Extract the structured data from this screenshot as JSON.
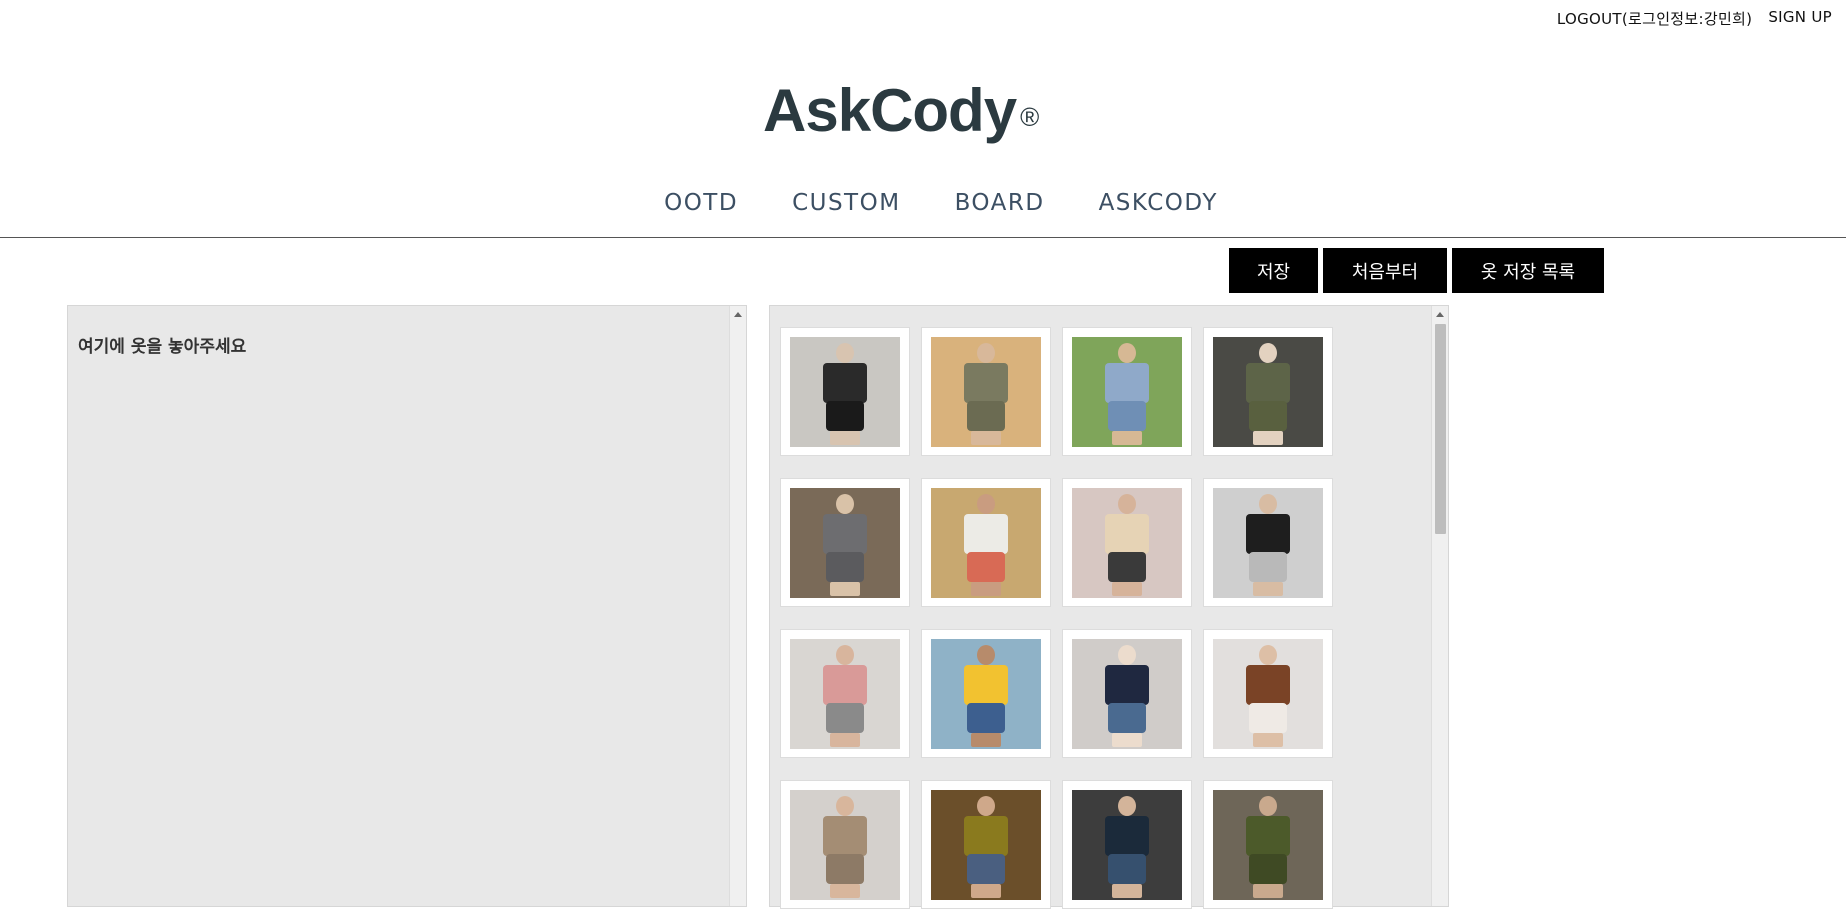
{
  "header": {
    "logout_label": "LOGOUT(로그인정보:강민희)",
    "signup_label": "SIGN UP"
  },
  "logo": {
    "text": "AskCody",
    "mark": "®"
  },
  "nav": {
    "items": [
      {
        "label": "OOTD"
      },
      {
        "label": "CUSTOM"
      },
      {
        "label": "BOARD"
      },
      {
        "label": "ASKCODY"
      }
    ]
  },
  "actions": {
    "save_label": "저장",
    "reset_label": "처음부터",
    "saved_list_label": "옷 저장 목록"
  },
  "drop_area": {
    "hint": "여기에 옷을 놓아주세요"
  },
  "clothes": [
    {
      "bg": "#c9c7c2",
      "top": "#2a2a2a",
      "bottom": "#1a1a1a",
      "skin": "#d8c4b0"
    },
    {
      "bg": "#d9b27c",
      "top": "#7a7a60",
      "bottom": "#6b6b52",
      "skin": "#d8b89a"
    },
    {
      "bg": "#7fa55a",
      "top": "#8fa9c9",
      "bottom": "#6f8fb5",
      "skin": "#d6b894"
    },
    {
      "bg": "#4a4a45",
      "top": "#5d6448",
      "bottom": "#59603f",
      "skin": "#e3d2c0"
    },
    {
      "bg": "#7a6a58",
      "top": "#6d6d70",
      "bottom": "#5b5b5e",
      "skin": "#d9c2a8"
    },
    {
      "bg": "#c8a870",
      "top": "#ecebe6",
      "bottom": "#d86a55",
      "skin": "#c99c80"
    },
    {
      "bg": "#d7c7c2",
      "top": "#e6d3b5",
      "bottom": "#3a3a3a",
      "skin": "#d6b39a"
    },
    {
      "bg": "#cfcfcf",
      "top": "#1e1e1e",
      "bottom": "#b9b9b9",
      "skin": "#d8bca3"
    },
    {
      "bg": "#d9d6d2",
      "top": "#d99a98",
      "bottom": "#8a8a8a",
      "skin": "#d8b59d"
    },
    {
      "bg": "#8fb2c7",
      "top": "#f2c230",
      "bottom": "#3d5f8f",
      "skin": "#b78b6b"
    },
    {
      "bg": "#d0ccc9",
      "top": "#1f2840",
      "bottom": "#4a6a90",
      "skin": "#ecdccd"
    },
    {
      "bg": "#e2dfdd",
      "top": "#7a4326",
      "bottom": "#efeae5",
      "skin": "#ddbfa6"
    },
    {
      "bg": "#d4d0cc",
      "top": "#a48d74",
      "bottom": "#8d7a66",
      "skin": "#d8b69c"
    },
    {
      "bg": "#6b4f2a",
      "top": "#8a7a1e",
      "bottom": "#4a5f80",
      "skin": "#cfa88a"
    },
    {
      "bg": "#3d3d3d",
      "top": "#1b2a3a",
      "bottom": "#36506e",
      "skin": "#d3b49a"
    },
    {
      "bg": "#6e6658",
      "top": "#4c5a2a",
      "bottom": "#3f4a24",
      "skin": "#c9a98d"
    }
  ]
}
